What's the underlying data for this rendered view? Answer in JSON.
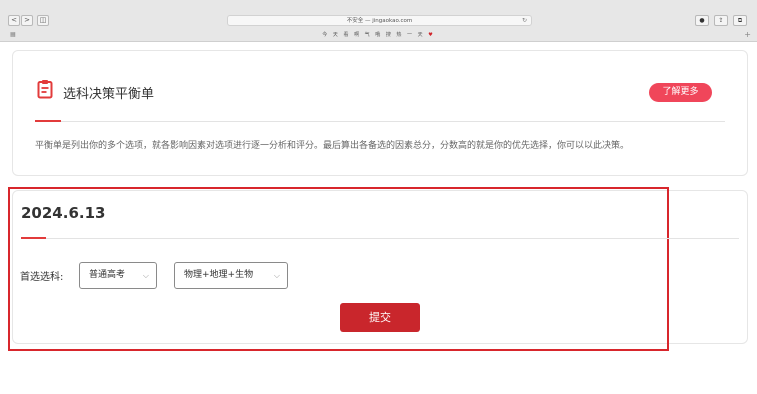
{
  "browser": {
    "back": "<",
    "forward": ">",
    "sidebar": "◫",
    "url": "不安全 — jingaokao.com",
    "bookmarks": "今 天 看 啊 气 哦 搜 热 一 天",
    "share": "⇪",
    "tabs": "⧉",
    "download": "●",
    "plus": "+"
  },
  "header_card": {
    "title": "选科决策平衡单",
    "learn_more": "了解更多",
    "description": "平衡单是列出你的多个选项，就各影响因素对选项进行逐一分析和评分。最后算出各备选的因素总分，分数高的就是你的优先选择，你可以以此决策。"
  },
  "form": {
    "date": "2024.6.13",
    "field_label": "首选选科:",
    "select1_value": "普通高考",
    "select2_value": "物理+地理+生物",
    "submit": "提交"
  },
  "colors": {
    "accent": "#e23b3b",
    "button_pink": "#f0465a",
    "submit_red": "#c9262c",
    "highlight_border": "#d8262c"
  }
}
